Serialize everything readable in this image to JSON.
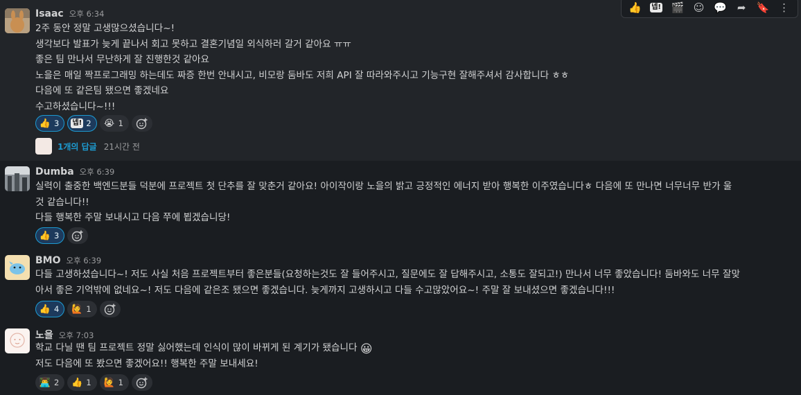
{
  "messages": [
    {
      "author": "Isaac",
      "time": "오후 6:34",
      "lines": [
        "2주 동안 정말 고생많으셨습니다~!",
        "생각보다 발표가 늦게 끝나서 회고 못하고 결혼기념일 외식하러 갈거 같아요 ㅠㅠ",
        "좋은 팀 만나서 무난하게 잘 진행한것 같아요",
        "노을은 매일 짝프로그래밍 하는데도 짜증 한번 안내시고, 비모랑 둠바도 저희 API 잘 따라와주시고 기능구현 잘해주셔서 감사합니다 ㅎㅎ",
        "다음에 또 같은팀 됐으면 좋겠네요",
        "수고하셨습니다~!!!"
      ],
      "reactions": [
        {
          "icon": "thumbs-up-icon",
          "glyph": "👍",
          "count": "3",
          "active": true
        },
        {
          "icon": "custom-emoji-icon",
          "glyph": "넵!",
          "count": "2",
          "active": true
        },
        {
          "icon": "crying-face-icon",
          "glyph": "😭",
          "count": "1",
          "active": false
        }
      ],
      "thread": {
        "replies": "1개의 답글",
        "ago": "21시간 전"
      }
    },
    {
      "author": "Dumba",
      "time": "오후 6:39",
      "lines": [
        "실력이 출중한 백엔드분들 덕분에 프로젝트 첫 단추를 잘 맞춘거 같아요! 아이작이랑 노을의 밝고 긍정적인 에너지 받아 행복한 이주였습니다ㅎ 다음에 또 만나면 너무너무 반가 울",
        "것 같습니다!!",
        "다들 행복한 주말 보내시고 다음 쭈에 뵙겠습니당!"
      ],
      "reactions": [
        {
          "icon": "thumbs-up-icon",
          "glyph": "👍",
          "count": "3",
          "active": true
        }
      ]
    },
    {
      "author": "BMO",
      "time": "오후 6:39",
      "lines": [
        "다들 고생하셨습니다~! 저도 사실 처음 프로젝트부터 좋은분들(요청하는것도 잘 들어주시고, 질문에도 잘 답해주시고, 소통도 잘되고!) 만나서 너무 좋았습니다! 둠바와도 너무 잘맞",
        "아서 좋은 기억밖에 없네요~! 저도 다음에 같은조 됐으면 좋겠습니다. 늦게까지 고생하시고 다들 수고많았어요~! 주말 잘 보내셨으면 좋겠습니다!!!"
      ],
      "reactions": [
        {
          "icon": "thumbs-up-icon",
          "glyph": "👍",
          "count": "4",
          "active": true
        },
        {
          "icon": "custom-emoji-icon",
          "glyph": "🙋",
          "count": "1",
          "active": false
        }
      ]
    },
    {
      "author": "노을",
      "time": "오후 7:03",
      "lines": [
        "학교 다닐 땐 팀 프로젝트 정말 싫어했는데 인식이 많이 바뀌게 된 계기가 됐습니다",
        "저도 다음에 또 봤으면 좋겠어요!! 행복한 주말 보내세요!"
      ],
      "inline_emoji": "😀",
      "reactions": [
        {
          "icon": "technologist-icon",
          "glyph": "👨‍💻",
          "count": "2",
          "active": false
        },
        {
          "icon": "thumbs-up-icon",
          "glyph": "👍",
          "count": "1",
          "active": false
        },
        {
          "icon": "custom-emoji-icon",
          "glyph": "🙋",
          "count": "1",
          "active": false
        }
      ]
    }
  ],
  "toolbar": [
    {
      "name": "toolbar-thumbs-up",
      "glyph": "👍"
    },
    {
      "name": "toolbar-custom-emoji",
      "glyph": "넵!"
    },
    {
      "name": "toolbar-clapper",
      "glyph": "🎬"
    },
    {
      "name": "toolbar-add-reaction",
      "glyph": "☺"
    },
    {
      "name": "toolbar-reply-thread",
      "glyph": "💬"
    },
    {
      "name": "toolbar-share",
      "glyph": "➦"
    },
    {
      "name": "toolbar-bookmark",
      "glyph": "🔖"
    },
    {
      "name": "toolbar-more",
      "glyph": "⋮"
    }
  ]
}
